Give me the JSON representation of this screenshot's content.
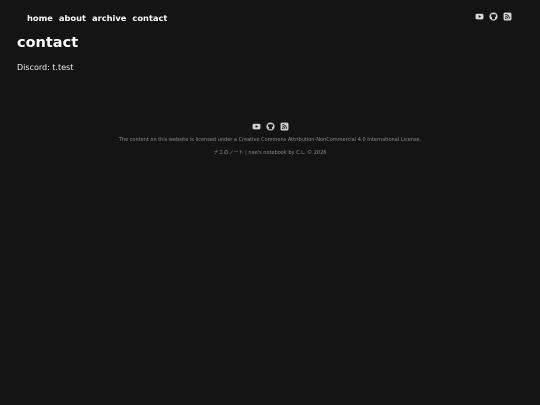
{
  "nav": {
    "items": [
      {
        "label": "home"
      },
      {
        "label": "about"
      },
      {
        "label": "archive"
      },
      {
        "label": "contact"
      }
    ]
  },
  "social": {
    "icons": [
      "youtube-icon",
      "github-icon",
      "rss-icon"
    ]
  },
  "page": {
    "title": "contact",
    "discord": "Discord: t.test"
  },
  "footer": {
    "license": "The content on this website is licensed under a Creative Commons Attribution-NonCommercial 4.0 International License.",
    "copyright": "ナエのノート | nae's notebook by C.L. © 2026"
  },
  "colors": {
    "background": "#141414",
    "text": "#ffffff",
    "muted": "#8c8c8c"
  }
}
